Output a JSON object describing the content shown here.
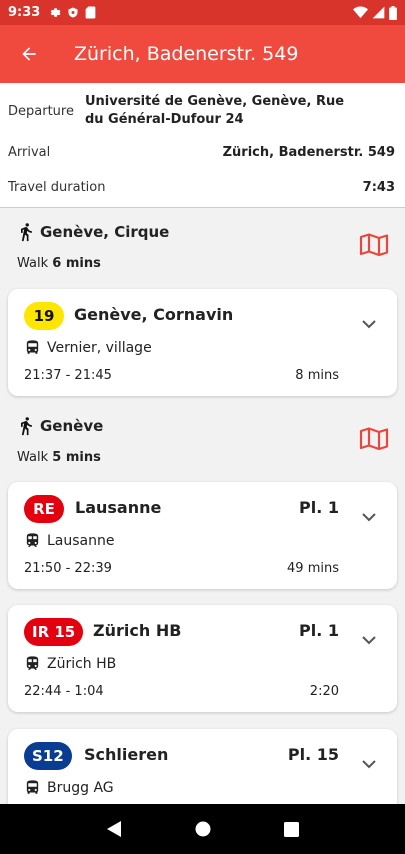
{
  "status_bar": {
    "time": "9:33"
  },
  "app_bar": {
    "title": "Zürich, Badenerstr. 549"
  },
  "summary": {
    "departure_label": "Departure",
    "departure_value": "Université de Genève, Genève, Rue du Général-Dufour 24",
    "arrival_label": "Arrival",
    "arrival_value": "Zürich, Badenerstr. 549",
    "duration_label": "Travel duration",
    "duration_value": "7:43"
  },
  "walks": [
    {
      "title": "Genève, Cirque",
      "prefix": "Walk",
      "duration": "6 mins"
    },
    {
      "title": "Genève",
      "prefix": "Walk",
      "duration": "5 mins"
    }
  ],
  "legs": [
    {
      "line": "19",
      "badge_bg": "#ffe600",
      "badge_fg": "#111111",
      "destination": "Genève, Cornavin",
      "platform": "",
      "vehicle": "bus-icon",
      "via": "Vernier, village",
      "times": "21:37 - 21:45",
      "duration": "8 mins"
    },
    {
      "line": "RE",
      "badge_bg": "#e3000f",
      "badge_fg": "#ffffff",
      "destination": "Lausanne",
      "platform": "Pl. 1",
      "vehicle": "train-icon",
      "via": "Lausanne",
      "times": "21:50 - 22:39",
      "duration": "49 mins"
    },
    {
      "line": "IR 15",
      "badge_bg": "#e3000f",
      "badge_fg": "#ffffff",
      "destination": "Zürich HB",
      "platform": "Pl. 1",
      "vehicle": "train-icon",
      "via": "Zürich HB",
      "times": "22:44 - 1:04",
      "duration": "2:20"
    },
    {
      "line": "S12",
      "badge_bg": "#0a3d91",
      "badge_fg": "#ffffff",
      "destination": "Schlieren",
      "platform": "Pl. 15",
      "vehicle": "train-icon",
      "via": "Brugg AG",
      "times": "",
      "duration": ""
    }
  ],
  "colors": {
    "app_bar": "#f04a3e",
    "status_bar": "#d9342b",
    "accent": "#e8473b"
  }
}
